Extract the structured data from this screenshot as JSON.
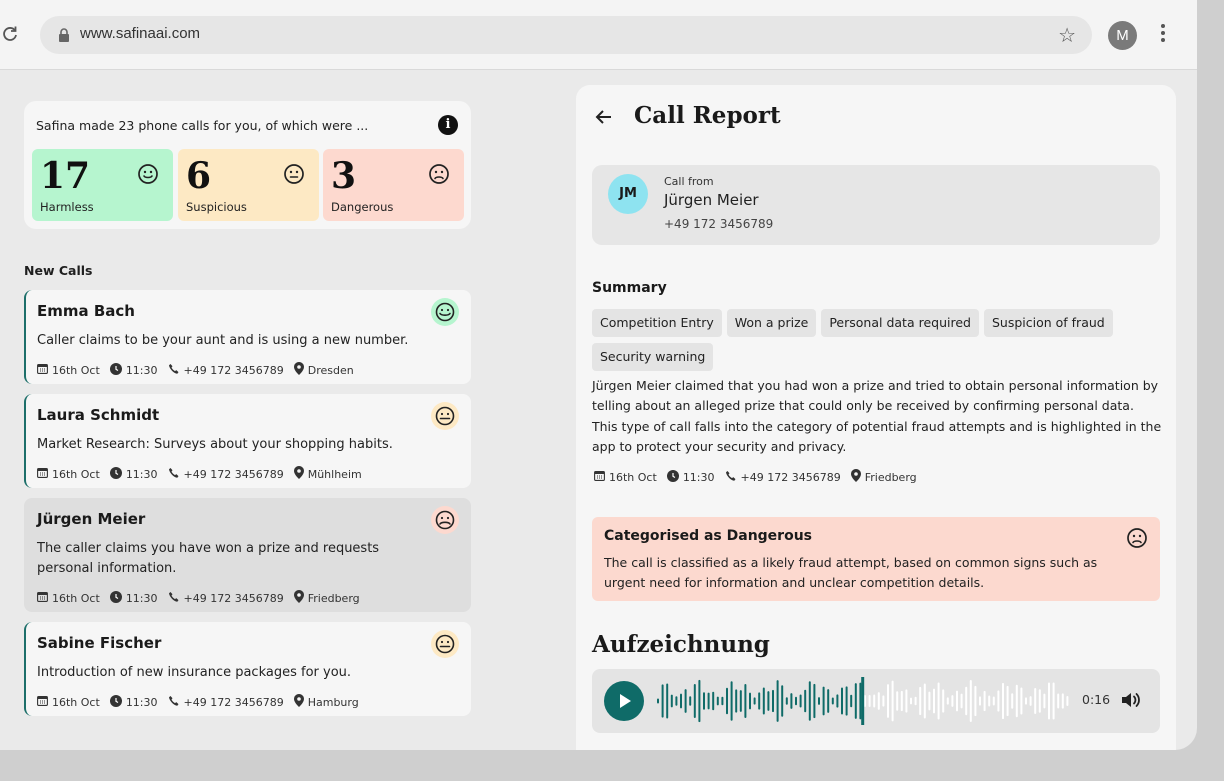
{
  "browser": {
    "url": "www.safinaai.com",
    "profile_initial": "M"
  },
  "stats": {
    "intro": "Safina made 23 phone calls for you, of which were ...",
    "items": [
      {
        "count": "17",
        "label": "Harmless",
        "color": "#b6f5cf",
        "mood": "happy"
      },
      {
        "count": "6",
        "label": "Suspicious",
        "color": "#fde9c4",
        "mood": "neutral"
      },
      {
        "count": "3",
        "label": "Dangerous",
        "color": "#fdd9cf",
        "mood": "sad"
      }
    ]
  },
  "new_calls_title": "New Calls",
  "calls": [
    {
      "name": "Emma Bach",
      "description": "Caller claims to be your aunt and is using a new number.",
      "date": "16th Oct",
      "time": "11:30",
      "phone": "+49 172 3456789",
      "location": "Dresden",
      "mood": "happy"
    },
    {
      "name": "Laura Schmidt",
      "description": "Market Research: Surveys about your shopping habits.",
      "date": "16th Oct",
      "time": "11:30",
      "phone": "+49 172 3456789",
      "location": "Mühlheim",
      "mood": "neutral"
    },
    {
      "name": "Jürgen Meier",
      "description": "The caller claims you have won a prize and requests personal information.",
      "date": "16th Oct",
      "time": "11:30",
      "phone": "+49 172 3456789",
      "location": "Friedberg",
      "mood": "sad"
    },
    {
      "name": "Sabine Fischer",
      "description": "Introduction of new insurance packages for you.",
      "date": "16th Oct",
      "time": "11:30",
      "phone": "+49 172 3456789",
      "location": "Hamburg",
      "mood": "neutral"
    }
  ],
  "report": {
    "title": "Call Report",
    "caller": {
      "initials": "JM",
      "label": "Call from",
      "name": "Jürgen Meier",
      "phone": "+49 172 3456789"
    },
    "summary_title": "Summary",
    "tags": [
      "Competition Entry",
      "Won a prize",
      "Personal data required",
      "Suspicion of fraud",
      "Security warning"
    ],
    "summary": "Jürgen Meier claimed that you had won a prize and tried to obtain personal information by telling about an alleged prize that could only be received by confirming personal data. This type of call falls into the category of potential fraud attempts and is highlighted in the app to protect your security and privacy.",
    "meta": {
      "date": "16th Oct",
      "time": "11:30",
      "phone": "+49 172 3456789",
      "location": "Friedberg"
    },
    "category": {
      "title": "Categorised as Dangerous",
      "text": "The call is classified as a likely fraud attempt, based on common signs such as urgent need for information and unclear competition details."
    },
    "recording": {
      "title": "Aufzeichnung",
      "time": "0:16",
      "progress": 0.5
    }
  },
  "colors": {
    "accent": "#0f6b68",
    "happy": "#b6f5cf",
    "neutral": "#fde9c4",
    "sad": "#fdd9cf"
  }
}
